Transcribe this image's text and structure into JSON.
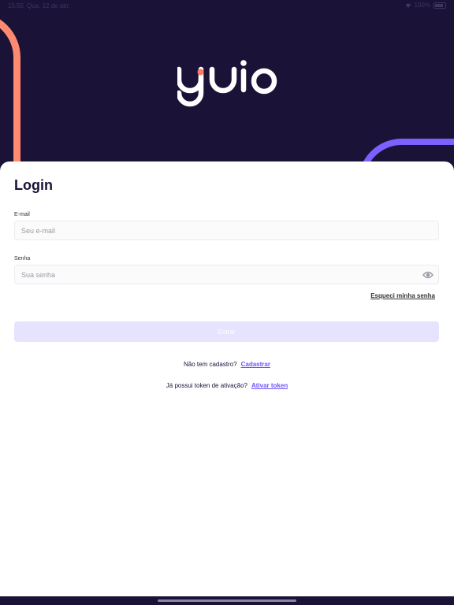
{
  "status_bar": {
    "time": "15:55",
    "date": "Qua. 12 de abr.",
    "battery": "100%"
  },
  "brand": {
    "logo_text": "guio",
    "colors": {
      "primary_dark": "#1b1237",
      "accent_orange": "#ff8a70",
      "accent_purple": "#7b61ff",
      "link": "#6d55ff"
    }
  },
  "login": {
    "title": "Login",
    "email": {
      "label": "E-mail",
      "placeholder": "Seu e-mail",
      "value": ""
    },
    "password": {
      "label": "Senha",
      "placeholder": "Sua senha",
      "value": "",
      "toggle_icon": "eye-icon"
    },
    "forgot_label": "Esqueci minha senha",
    "submit_label": "Entrar"
  },
  "signup": {
    "prompt": "Não tem cadastro?",
    "link": "Cadastrar"
  },
  "activation": {
    "prompt": "Já possui token de ativação?",
    "link": "Ativar token"
  }
}
